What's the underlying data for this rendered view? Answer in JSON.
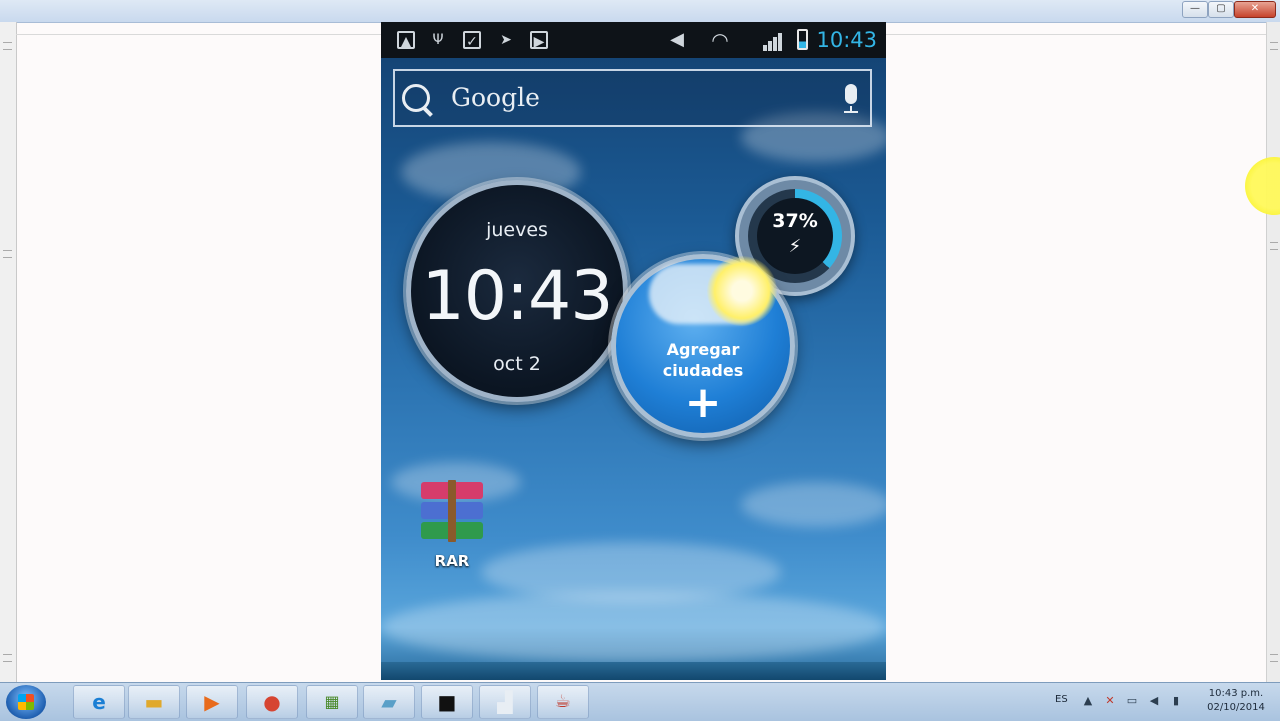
{
  "window": {
    "controls": {
      "minimize": "—",
      "maximize": "▢",
      "close": "✕"
    }
  },
  "phone": {
    "statusbar": {
      "time": "10:43",
      "battery_percent": 37,
      "left_icons": [
        "upload-icon",
        "usb-icon",
        "checkmark-icon",
        "twitter-icon",
        "shopping-bag-icon"
      ],
      "right_icons": [
        "speaker-mute-icon",
        "wifi-icon",
        "signal-icon",
        "battery-icon"
      ],
      "time_color": "#33b5e5"
    },
    "search": {
      "label": "Google"
    },
    "clock": {
      "day": "jueves",
      "time": "10:43",
      "date": "oct 2"
    },
    "weather": {
      "line1": "Agregar",
      "line2": "ciudades",
      "plus": "+"
    },
    "battery_widget": {
      "percent": "37%",
      "fraction": 0.37
    },
    "apps": [
      {
        "label": "RAR"
      }
    ]
  },
  "taskbar": {
    "items": [
      "start-button",
      "internet-explorer",
      "file-explorer",
      "media-player",
      "chrome",
      "apps-grid",
      "notepad",
      "command-prompt",
      "paint",
      "java"
    ],
    "tray": {
      "language": "ES",
      "clock_time": "10:43 p.m.",
      "clock_date": "02/10/2014"
    }
  }
}
